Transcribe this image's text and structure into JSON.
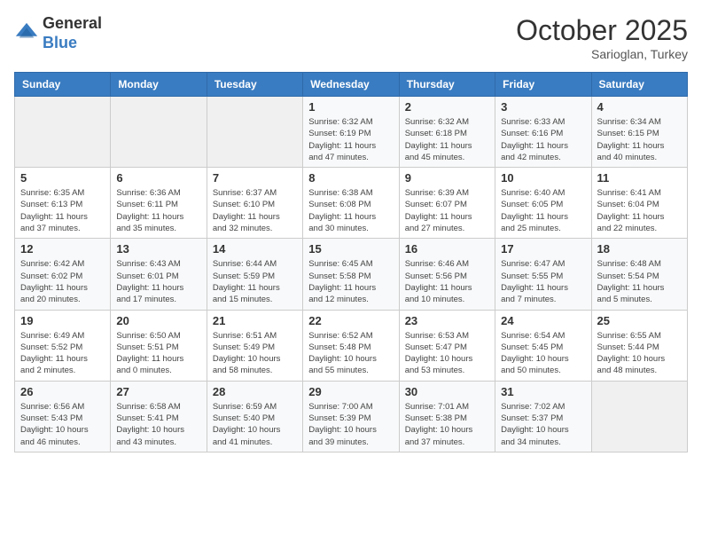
{
  "header": {
    "logo_line1": "General",
    "logo_line2": "Blue",
    "month": "October 2025",
    "location": "Sarioglan, Turkey"
  },
  "weekdays": [
    "Sunday",
    "Monday",
    "Tuesday",
    "Wednesday",
    "Thursday",
    "Friday",
    "Saturday"
  ],
  "weeks": [
    [
      {
        "day": "",
        "info": ""
      },
      {
        "day": "",
        "info": ""
      },
      {
        "day": "",
        "info": ""
      },
      {
        "day": "1",
        "info": "Sunrise: 6:32 AM\nSunset: 6:19 PM\nDaylight: 11 hours\nand 47 minutes."
      },
      {
        "day": "2",
        "info": "Sunrise: 6:32 AM\nSunset: 6:18 PM\nDaylight: 11 hours\nand 45 minutes."
      },
      {
        "day": "3",
        "info": "Sunrise: 6:33 AM\nSunset: 6:16 PM\nDaylight: 11 hours\nand 42 minutes."
      },
      {
        "day": "4",
        "info": "Sunrise: 6:34 AM\nSunset: 6:15 PM\nDaylight: 11 hours\nand 40 minutes."
      }
    ],
    [
      {
        "day": "5",
        "info": "Sunrise: 6:35 AM\nSunset: 6:13 PM\nDaylight: 11 hours\nand 37 minutes."
      },
      {
        "day": "6",
        "info": "Sunrise: 6:36 AM\nSunset: 6:11 PM\nDaylight: 11 hours\nand 35 minutes."
      },
      {
        "day": "7",
        "info": "Sunrise: 6:37 AM\nSunset: 6:10 PM\nDaylight: 11 hours\nand 32 minutes."
      },
      {
        "day": "8",
        "info": "Sunrise: 6:38 AM\nSunset: 6:08 PM\nDaylight: 11 hours\nand 30 minutes."
      },
      {
        "day": "9",
        "info": "Sunrise: 6:39 AM\nSunset: 6:07 PM\nDaylight: 11 hours\nand 27 minutes."
      },
      {
        "day": "10",
        "info": "Sunrise: 6:40 AM\nSunset: 6:05 PM\nDaylight: 11 hours\nand 25 minutes."
      },
      {
        "day": "11",
        "info": "Sunrise: 6:41 AM\nSunset: 6:04 PM\nDaylight: 11 hours\nand 22 minutes."
      }
    ],
    [
      {
        "day": "12",
        "info": "Sunrise: 6:42 AM\nSunset: 6:02 PM\nDaylight: 11 hours\nand 20 minutes."
      },
      {
        "day": "13",
        "info": "Sunrise: 6:43 AM\nSunset: 6:01 PM\nDaylight: 11 hours\nand 17 minutes."
      },
      {
        "day": "14",
        "info": "Sunrise: 6:44 AM\nSunset: 5:59 PM\nDaylight: 11 hours\nand 15 minutes."
      },
      {
        "day": "15",
        "info": "Sunrise: 6:45 AM\nSunset: 5:58 PM\nDaylight: 11 hours\nand 12 minutes."
      },
      {
        "day": "16",
        "info": "Sunrise: 6:46 AM\nSunset: 5:56 PM\nDaylight: 11 hours\nand 10 minutes."
      },
      {
        "day": "17",
        "info": "Sunrise: 6:47 AM\nSunset: 5:55 PM\nDaylight: 11 hours\nand 7 minutes."
      },
      {
        "day": "18",
        "info": "Sunrise: 6:48 AM\nSunset: 5:54 PM\nDaylight: 11 hours\nand 5 minutes."
      }
    ],
    [
      {
        "day": "19",
        "info": "Sunrise: 6:49 AM\nSunset: 5:52 PM\nDaylight: 11 hours\nand 2 minutes."
      },
      {
        "day": "20",
        "info": "Sunrise: 6:50 AM\nSunset: 5:51 PM\nDaylight: 11 hours\nand 0 minutes."
      },
      {
        "day": "21",
        "info": "Sunrise: 6:51 AM\nSunset: 5:49 PM\nDaylight: 10 hours\nand 58 minutes."
      },
      {
        "day": "22",
        "info": "Sunrise: 6:52 AM\nSunset: 5:48 PM\nDaylight: 10 hours\nand 55 minutes."
      },
      {
        "day": "23",
        "info": "Sunrise: 6:53 AM\nSunset: 5:47 PM\nDaylight: 10 hours\nand 53 minutes."
      },
      {
        "day": "24",
        "info": "Sunrise: 6:54 AM\nSunset: 5:45 PM\nDaylight: 10 hours\nand 50 minutes."
      },
      {
        "day": "25",
        "info": "Sunrise: 6:55 AM\nSunset: 5:44 PM\nDaylight: 10 hours\nand 48 minutes."
      }
    ],
    [
      {
        "day": "26",
        "info": "Sunrise: 6:56 AM\nSunset: 5:43 PM\nDaylight: 10 hours\nand 46 minutes."
      },
      {
        "day": "27",
        "info": "Sunrise: 6:58 AM\nSunset: 5:41 PM\nDaylight: 10 hours\nand 43 minutes."
      },
      {
        "day": "28",
        "info": "Sunrise: 6:59 AM\nSunset: 5:40 PM\nDaylight: 10 hours\nand 41 minutes."
      },
      {
        "day": "29",
        "info": "Sunrise: 7:00 AM\nSunset: 5:39 PM\nDaylight: 10 hours\nand 39 minutes."
      },
      {
        "day": "30",
        "info": "Sunrise: 7:01 AM\nSunset: 5:38 PM\nDaylight: 10 hours\nand 37 minutes."
      },
      {
        "day": "31",
        "info": "Sunrise: 7:02 AM\nSunset: 5:37 PM\nDaylight: 10 hours\nand 34 minutes."
      },
      {
        "day": "",
        "info": ""
      }
    ]
  ]
}
